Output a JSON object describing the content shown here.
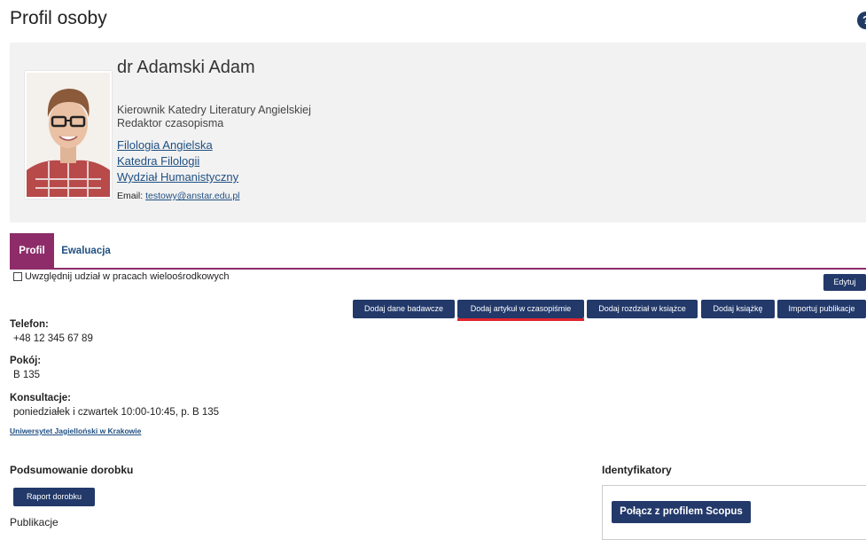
{
  "page": {
    "title": "Profil osoby",
    "help_icon": "?"
  },
  "person": {
    "name": "dr Adamski Adam",
    "roles": [
      "Kierownik Katedry Literatury Angielskiej",
      "Redaktor czasopisma"
    ],
    "units": [
      "Filologia Angielska",
      "Katedra Filologii",
      "Wydział Humanistyczny"
    ],
    "email_label": "Email:",
    "email": "testowy@anstar.edu.pl",
    "avatar_icon": "person-photo"
  },
  "tabs": [
    {
      "label": "Profil",
      "active": true
    },
    {
      "label": "Ewaluacja",
      "active": false
    }
  ],
  "toolbar": {
    "include_checkbox_label": "Uwzględnij udział w pracach wieloośrodkowych",
    "edit_label": "Edytuj",
    "actions": [
      {
        "label": "Dodaj dane badawcze"
      },
      {
        "label": "Dodaj artykuł w czasopiśmie",
        "active": true
      },
      {
        "label": "Dodaj rozdział w książce"
      },
      {
        "label": "Dodaj książkę"
      },
      {
        "label": "Importuj publikacje"
      }
    ]
  },
  "contact": {
    "phone_label": "Telefon:",
    "phone": "+48 12 345 67 89",
    "room_label": "Pokój:",
    "room": "B 135",
    "consult_label": "Konsultacje:",
    "consult": "poniedziałek i czwartek 10:00-10:45, p. B 135",
    "university": "Uniwersytet Jagielloński w Krakowie"
  },
  "summary": {
    "heading": "Podsumowanie dorobku",
    "report_label": "Raport dorobku",
    "publications_label": "Publikacje"
  },
  "identifiers": {
    "heading": "Identyfikatory",
    "scopus_label": "Połącz z profilem Scopus"
  },
  "colors": {
    "accent": "#8e2c6a",
    "button": "#22396a",
    "link": "#1f4f82",
    "active_underline": "#e0262e",
    "card_bg": "#f2f2f2"
  }
}
